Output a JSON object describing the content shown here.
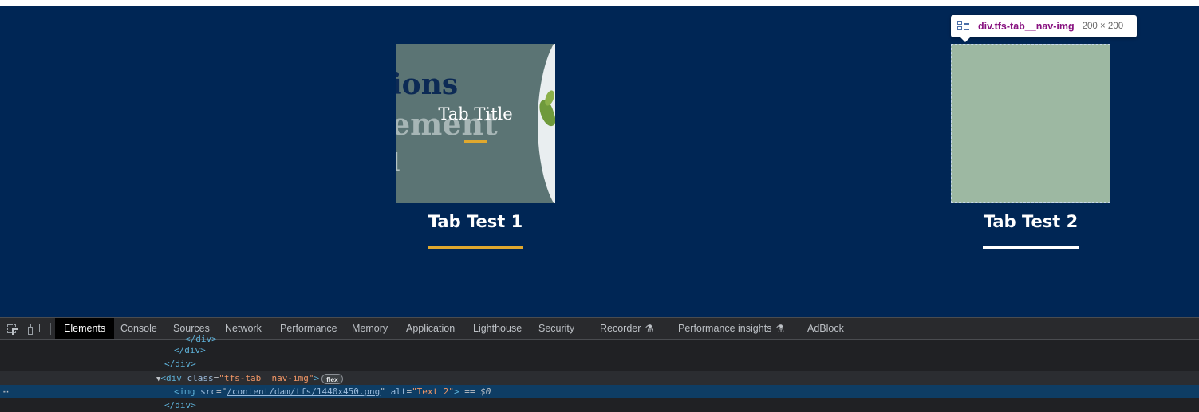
{
  "tabs": [
    {
      "label": "Tab Test 1",
      "thumbnail": {
        "background_words": [
          "ions",
          "ement",
          "l"
        ],
        "overlay_title": "Tab Title"
      },
      "underline_color": "#e0a82e"
    },
    {
      "label": "Tab Test 2",
      "underline_color": "#ffffff"
    }
  ],
  "inspector_tooltip": {
    "selector": "div.tfs-tab__nav-img",
    "size": "200 × 200",
    "icon": "flex-layout-icon"
  },
  "devtools": {
    "tabs": [
      {
        "label": "Elements",
        "active": true
      },
      {
        "label": "Console"
      },
      {
        "label": "Sources"
      },
      {
        "label": "Network"
      },
      {
        "label": "Performance"
      },
      {
        "label": "Memory"
      },
      {
        "label": "Application"
      },
      {
        "label": "Lighthouse"
      },
      {
        "label": "Security"
      },
      {
        "label": "Recorder",
        "icon": "flask-icon"
      },
      {
        "label": "Performance insights",
        "icon": "flask-icon"
      },
      {
        "label": "AdBlock"
      }
    ],
    "code": {
      "line0": "</div>",
      "line1": "</div>",
      "line2": "</div>",
      "line3_tag_open": "<div",
      "line3_attr_name": "class",
      "line3_attr_value": "\"tfs-tab__nav-img\"",
      "line3_tag_close": ">",
      "line3_badge": "flex",
      "line4_tag_open": "<img",
      "line4_src_name": "src",
      "line4_src_value": "/content/dam/tfs/1440x450.png",
      "line4_alt_name": "alt",
      "line4_alt_value": "\"Text 2\"",
      "line4_tag_close": ">",
      "line4_eq": "==",
      "line4_var": "$0",
      "line5": "</div>"
    }
  },
  "colors": {
    "page_bg": "#002655",
    "accent_gold": "#e0a82e",
    "tab2_thumb": "#9db8a2"
  }
}
